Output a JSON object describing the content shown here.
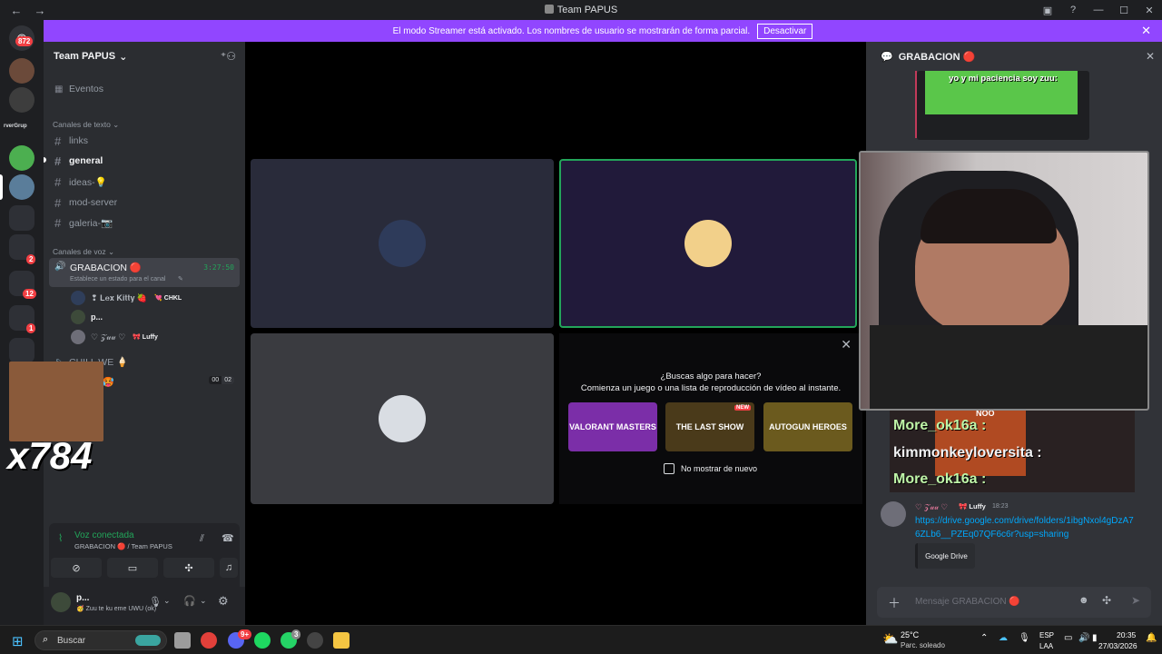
{
  "titlebar": {
    "title": "Team PAPUS",
    "back": "←",
    "forward": "→"
  },
  "banner": {
    "text": "El modo Streamer está activado. Los nombres de usuario se mostrarán de forma parcial.",
    "button": "Desactivar"
  },
  "rail": {
    "badges": [
      "872",
      "12",
      "2",
      "1"
    ],
    "folder_label": "rverGrup"
  },
  "guild": {
    "name": "Team PAPUS",
    "events_label": "Eventos"
  },
  "text_category": "Canales de texto",
  "text_channels": [
    {
      "name": "links"
    },
    {
      "name": "general"
    },
    {
      "name": "ideas-💡"
    },
    {
      "name": "mod-server"
    },
    {
      "name": "galeria-📷"
    }
  ],
  "voice_category": "Canales de voz",
  "voice_channel": {
    "name": "GRABACION 🔴",
    "timer": "3:27:50",
    "status_prompt": "Establece un estado para el canal",
    "users": [
      {
        "name": "❢ 𝐋𝐞𝐱 𝐊𝐢𝐭𝐭𝐲 🍓",
        "tag": "💘 CHKL"
      },
      {
        "name": "p...",
        "tag": ""
      },
      {
        "name": "♡ 𝒵𝓊𝓊 ♡",
        "tag": "🎀 Luffy"
      }
    ]
  },
  "other_voice": [
    {
      "name": "CHILL WE 🍦"
    },
    {
      "name": "LO WE 🥵",
      "counts": [
        "00",
        "02"
      ]
    }
  ],
  "overlay": {
    "cheer_text": "x784"
  },
  "voice_panel": {
    "status": "Voz conectada",
    "channel": "GRABACION 🔴 / Team PAPUS"
  },
  "user_panel": {
    "name": "p...",
    "status": "🥳 Zuu te ku eme UWU (ok)"
  },
  "activity": {
    "question": "¿Buscas algo para hacer?",
    "subtitle": "Comienza un juego o una lista de reproducción de vídeo al instante.",
    "games": [
      {
        "name": "VALORANT MASTERS"
      },
      {
        "name": "THE LAST SHOW",
        "badge": "NEW"
      },
      {
        "name": "AUTOGUN HEROES"
      }
    ],
    "dont_show": "No mostrar de nuevo"
  },
  "chat": {
    "title": "GRABACION 🔴",
    "image_caption": "yo y mi paciencia soy zuu:",
    "overlay_lines": [
      {
        "user": "More_ok16a :"
      },
      {
        "user": "kimmonkeyloversita :"
      },
      {
        "user": "More_ok16a :"
      }
    ],
    "overlay_top": "NOO",
    "message": {
      "author": "♡ 𝒵𝓊𝓊 ♡",
      "tag": "🎀 Luffy",
      "time": "18:23",
      "link": "https://drive.google.com/drive/folders/1ibgNxol4gDzA76ZLb6__PZEq07QF6c6r?usp=sharing",
      "embed": "Google Drive"
    },
    "input_placeholder": "Mensaje GRABACION 🔴"
  },
  "taskbar": {
    "search": "Buscar",
    "weather_temp": "25°C",
    "weather_desc": "Parc. soleado",
    "lang": "ESP",
    "layout": "LAA",
    "time": "20:35",
    "date": "27/03/2026",
    "discord_badge": "9+",
    "whatsapp_badge": "3"
  },
  "colors": {
    "accent": "#9146ff",
    "rail": "#1e1f22",
    "sidebar": "#2b2d31",
    "chat": "#313338",
    "green": "#23a55a",
    "red": "#f23f43",
    "link": "#00a8fc"
  }
}
